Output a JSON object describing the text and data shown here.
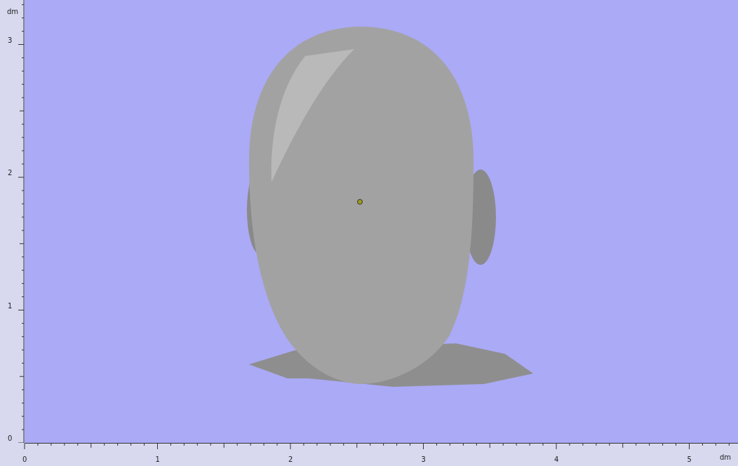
{
  "vertical_ruler": {
    "unit": "dm",
    "labels": [
      "3",
      "2",
      "1",
      "0"
    ]
  },
  "horizontal_ruler": {
    "unit": "dm",
    "labels": [
      "0",
      "1",
      "2",
      "3",
      "4",
      "5"
    ]
  }
}
